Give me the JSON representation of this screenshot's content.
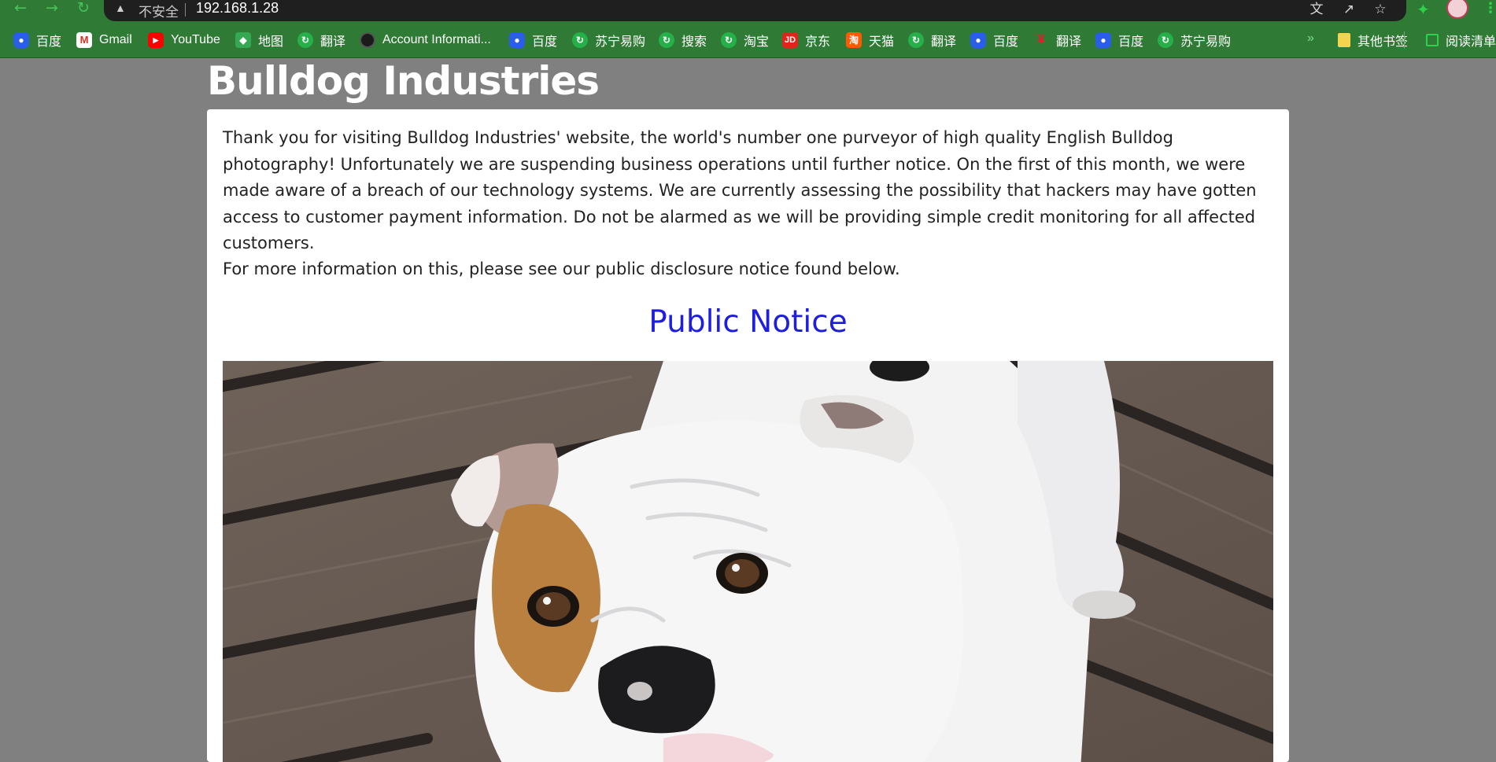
{
  "browser": {
    "url": "192.168.1.28",
    "security_label": "不安全",
    "bookmarks": [
      {
        "label": "百度",
        "icon": "baidu-icon"
      },
      {
        "label": "Gmail",
        "icon": "gmail-icon"
      },
      {
        "label": "YouTube",
        "icon": "youtube-icon"
      },
      {
        "label": "地图",
        "icon": "maps-icon"
      },
      {
        "label": "翻译",
        "icon": "translate-icon"
      },
      {
        "label": "Account Informati...",
        "icon": "account-icon"
      },
      {
        "label": "百度",
        "icon": "baidu-icon"
      },
      {
        "label": "苏宁易购",
        "icon": "suning-icon"
      },
      {
        "label": "搜索",
        "icon": "search-icon"
      },
      {
        "label": "淘宝",
        "icon": "taobao-icon"
      },
      {
        "label": "京东",
        "icon": "jd-icon"
      },
      {
        "label": "天猫",
        "icon": "tmall-icon"
      },
      {
        "label": "翻译",
        "icon": "translate-icon"
      },
      {
        "label": "百度",
        "icon": "baidu-icon"
      },
      {
        "label": "翻译",
        "icon": "fanyi-icon"
      },
      {
        "label": "百度",
        "icon": "baidu-icon"
      },
      {
        "label": "苏宁易购",
        "icon": "suning-icon"
      }
    ],
    "other_bookmarks": "其他书签",
    "reading_list": "阅读清单"
  },
  "page": {
    "title": "Bulldog Industries",
    "intro": "Thank you for visiting Bulldog Industries' website, the world's number one purveyor of high quality English Bulldog photography! Unfortunately we are suspending business operations until further notice. On the first of this month, we were made aware of a breach of our technology systems. We are currently assessing the possibility that hackers may have gotten access to customer payment information. Do not be alarmed as we will be providing simple credit monitoring for all affected customers.",
    "more_info": "For more information on this, please see our public disclosure notice found below.",
    "notice_link": "Public Notice",
    "image_subject": "english-bulldog-photo"
  },
  "colors": {
    "page_background": "#808080",
    "chrome_green": "#2f7a34",
    "link_blue": "#1e1ee0"
  }
}
